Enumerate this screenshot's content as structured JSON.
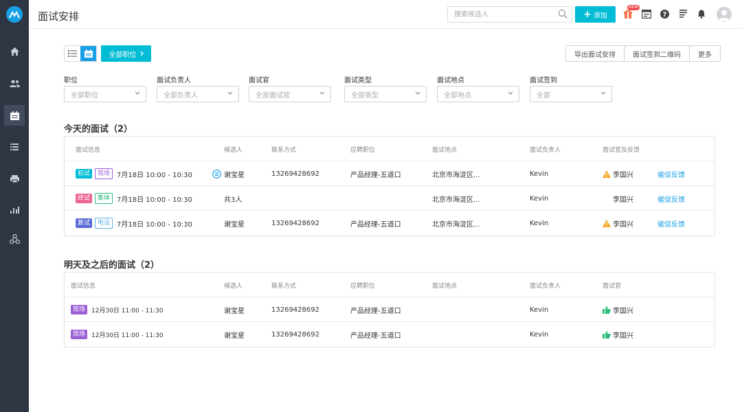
{
  "app": {
    "page_title": "面试安排"
  },
  "topbar": {
    "search_placeholder": "搜索候选人",
    "add_label": "添加",
    "new_badge": "NEW"
  },
  "toolbar": {
    "job_filter_label": "全部职位",
    "export_label": "导出面试安排",
    "qrcode_label": "面试签到二维码",
    "more_label": "更多"
  },
  "filters": [
    {
      "label": "职位",
      "placeholder": "全部职位"
    },
    {
      "label": "面试负责人",
      "placeholder": "全部负责人"
    },
    {
      "label": "面试官",
      "placeholder": "全部面试官"
    },
    {
      "label": "面试类型",
      "placeholder": "全部类型"
    },
    {
      "label": "面试地点",
      "placeholder": "全部地点"
    },
    {
      "label": "面试签到",
      "placeholder": "全部"
    }
  ],
  "today": {
    "title": "今天的面试（2）",
    "headers": {
      "info": "面试信息",
      "candidate": "候选人",
      "contact": "联系方式",
      "position": "应聘职位",
      "location": "面试地点",
      "owner": "面试负责人",
      "interviewer": "面试官及反馈"
    },
    "rows": [
      {
        "round": "初试",
        "round_color": "#00bcd4",
        "mode": "现场",
        "mode_color": "#9c5fd6",
        "time": "7月18日 10:00 - 10:30",
        "candidate": "谢宝星",
        "contact": "13269428692",
        "position": "产品经理-五道口",
        "location": "北京市海淀区...",
        "owner": "Kevin",
        "interviewer": "李国兴",
        "action": "催促反馈",
        "status": "warning"
      },
      {
        "round": "终试",
        "round_color": "#f06292",
        "mode": "集体",
        "mode_color": "#2ebf7a",
        "time": "7月18日 10:00 - 10:30",
        "candidate": "共3人",
        "contact": "",
        "position": "",
        "location": "北京市海淀区...",
        "owner": "Kevin",
        "interviewer": "李国兴",
        "action": "催促反馈",
        "status": "none"
      },
      {
        "round": "复试",
        "round_color": "#5b6bd6",
        "mode": "电话",
        "mode_color": "#5fb0e6",
        "time": "7月18日 10:00 - 10:30",
        "candidate": "谢宝星",
        "contact": "13269428692",
        "position": "产品经理-五道口",
        "location": "北京市海淀区...",
        "owner": "Kevin",
        "interviewer": "李国兴",
        "action": "催促反馈",
        "status": "warning"
      }
    ]
  },
  "upcoming": {
    "title": "明天及之后的面试（2）",
    "headers": {
      "info": "面试信息",
      "candidate": "候选人",
      "contact": "联系方式",
      "position": "应聘职位",
      "location": "面试地点",
      "owner": "面试负责人",
      "interviewer": "面试官"
    },
    "rows": [
      {
        "mode": "现场",
        "mode_color": "#9c5fd6",
        "time": "12月30日 11:00 - 11:30",
        "candidate": "谢宝星",
        "contact": "13269428692",
        "position": "产品经理-五道口",
        "location": "",
        "owner": "Kevin",
        "interviewer": "李国兴"
      },
      {
        "mode": "现场",
        "mode_color": "#9c5fd6",
        "time": "12月30日 11:00 - 11:30",
        "candidate": "谢宝星",
        "contact": "13269428692",
        "position": "产品经理-五道口",
        "location": "",
        "owner": "Kevin",
        "interviewer": "李国兴"
      }
    ]
  },
  "icons": {
    "logo": "logo-icon",
    "home": "home-icon",
    "people": "people-icon",
    "calendar": "calendar-icon",
    "list": "list-icon",
    "printer": "printer-icon",
    "chart": "bar-chart-icon",
    "network": "network-icon",
    "gift": "gift-icon",
    "window": "window-icon",
    "help": "help-icon",
    "doc": "document-icon",
    "bell": "bell-icon"
  },
  "colors": {
    "accent": "#00bcd4",
    "link": "#18a0e6",
    "sidebar": "#2e3644",
    "warning": "#f5a623",
    "thumb": "#2ebf7a"
  }
}
